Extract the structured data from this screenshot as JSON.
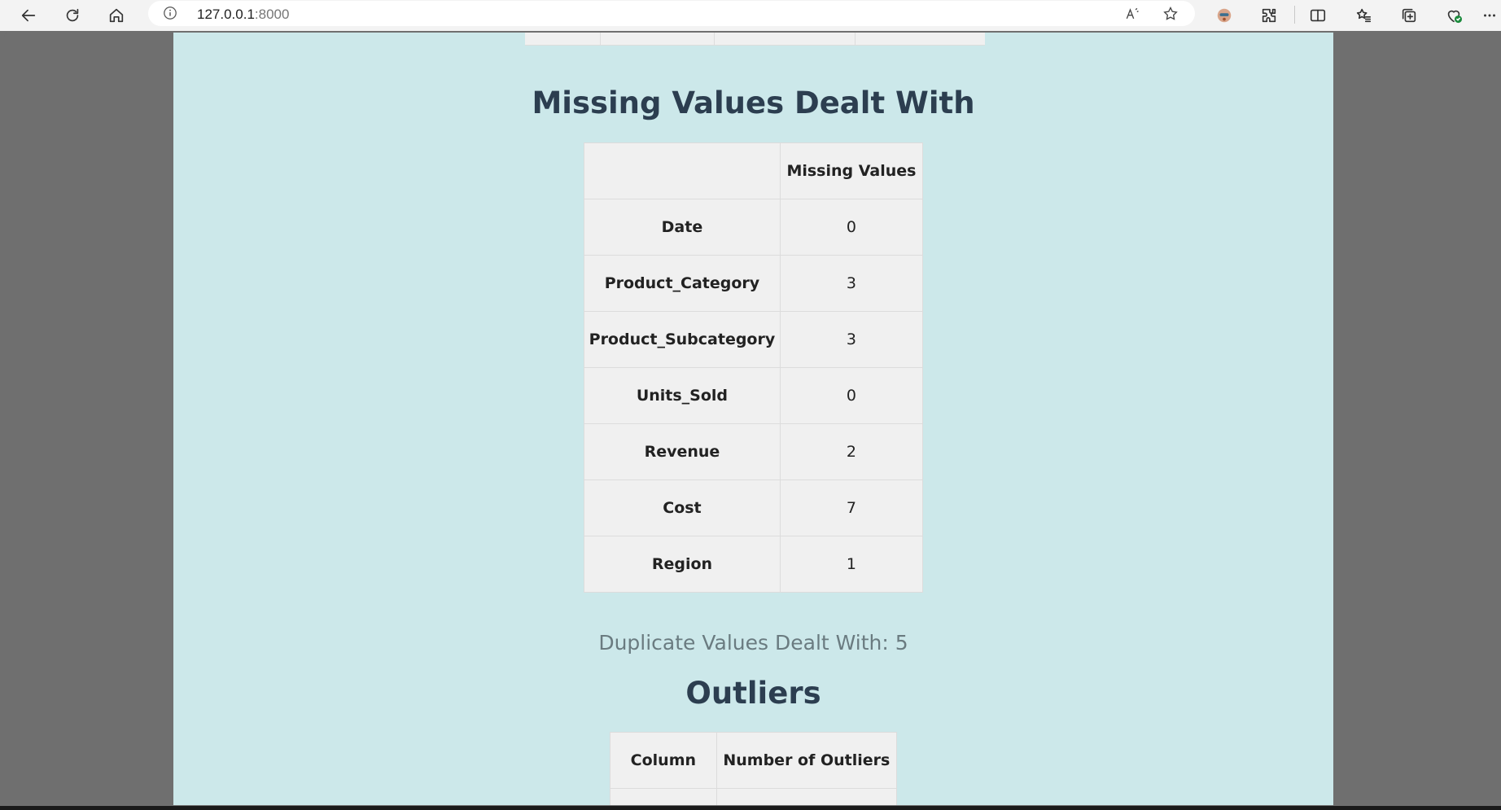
{
  "browser": {
    "url_host": "127.0.0.1",
    "url_port": ":8000"
  },
  "missing": {
    "title": "Missing Values Dealt With",
    "header_blank": "",
    "header_col": "Missing Values",
    "rows": [
      {
        "label": "Date",
        "value": "0"
      },
      {
        "label": "Product_Category",
        "value": "3"
      },
      {
        "label": "Product_Subcategory",
        "value": "3"
      },
      {
        "label": "Units_Sold",
        "value": "0"
      },
      {
        "label": "Revenue",
        "value": "2"
      },
      {
        "label": "Cost",
        "value": "7"
      },
      {
        "label": "Region",
        "value": "1"
      }
    ]
  },
  "duplicates": {
    "text": "Duplicate Values Dealt With: 5"
  },
  "outliers": {
    "title": "Outliers",
    "col1": "Column",
    "col2": "Number of Outliers"
  },
  "colors": {
    "page_bg": "#cce8ea",
    "table_bg": "#f0f0f0",
    "title": "#2c3e50",
    "subtext": "#6a7b80"
  }
}
